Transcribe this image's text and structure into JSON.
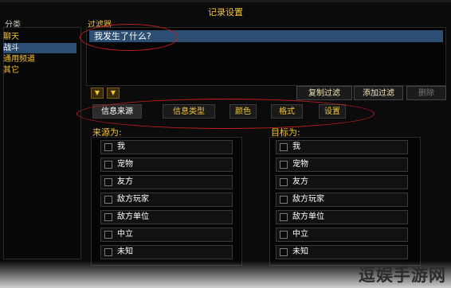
{
  "window": {
    "title": "记录设置"
  },
  "categories": {
    "header": "分类",
    "items": [
      "聊天",
      "战斗",
      "通用频道",
      "其它"
    ],
    "selected_index": 1
  },
  "filter": {
    "header": "过滤器",
    "rows": [
      "我发生了什么?"
    ]
  },
  "actions": {
    "copy": "复制过滤",
    "add": "添加过滤",
    "delete": "删除"
  },
  "tabs": [
    "信息来源",
    "信息类型",
    "颜色",
    "格式",
    "设置"
  ],
  "active_tab": 0,
  "source": {
    "title": "来源为:",
    "items": [
      "我",
      "宠物",
      "友方",
      "敌方玩家",
      "敌方单位",
      "中立",
      "未知"
    ]
  },
  "target": {
    "title": "目标为:",
    "items": [
      "我",
      "宠物",
      "友方",
      "敌方玩家",
      "敌方单位",
      "中立",
      "未知"
    ]
  },
  "watermark": "逗娱手游网",
  "colors": {
    "accent_gold": "#f2c43a",
    "selection_blue": "#2c4e73",
    "annotation_red": "#c21e1e"
  }
}
